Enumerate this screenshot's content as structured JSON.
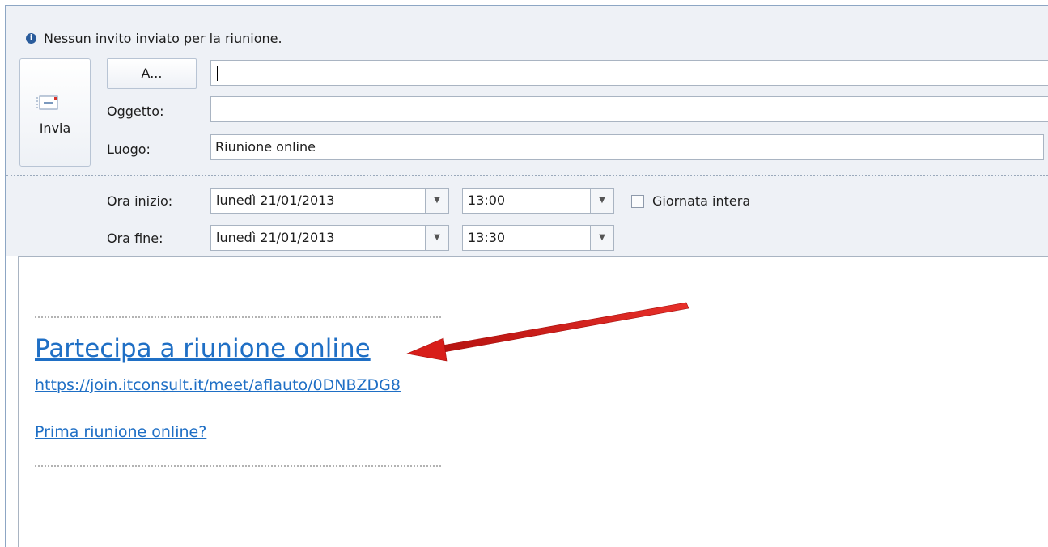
{
  "info_bar": {
    "icon": "info-icon",
    "text": "Nessun invito inviato per la riunione."
  },
  "send": {
    "label": "Invia",
    "icon": "envelope-send-icon"
  },
  "fields": {
    "to_button": "A...",
    "to_value": "",
    "subject_label": "Oggetto:",
    "subject_value": "",
    "location_label": "Luogo:",
    "location_value": "Riunione online"
  },
  "schedule": {
    "start_label": "Ora inizio:",
    "start_date": "lunedì 21/01/2013",
    "start_time": "13:00",
    "end_label": "Ora fine:",
    "end_date": "lunedì 21/01/2013",
    "end_time": "13:30",
    "all_day_label": "Giornata intera",
    "all_day_checked": false
  },
  "body": {
    "join_link": "Partecipa a riunione online",
    "meeting_url": "https://join.itconsult.it/meet/aflauto/0DNBZDG8",
    "first_meeting_link": "Prima riunione online?"
  },
  "colors": {
    "link": "#1f6fc5",
    "header_bg": "#eef1f6",
    "arrow": "#e0201e"
  }
}
